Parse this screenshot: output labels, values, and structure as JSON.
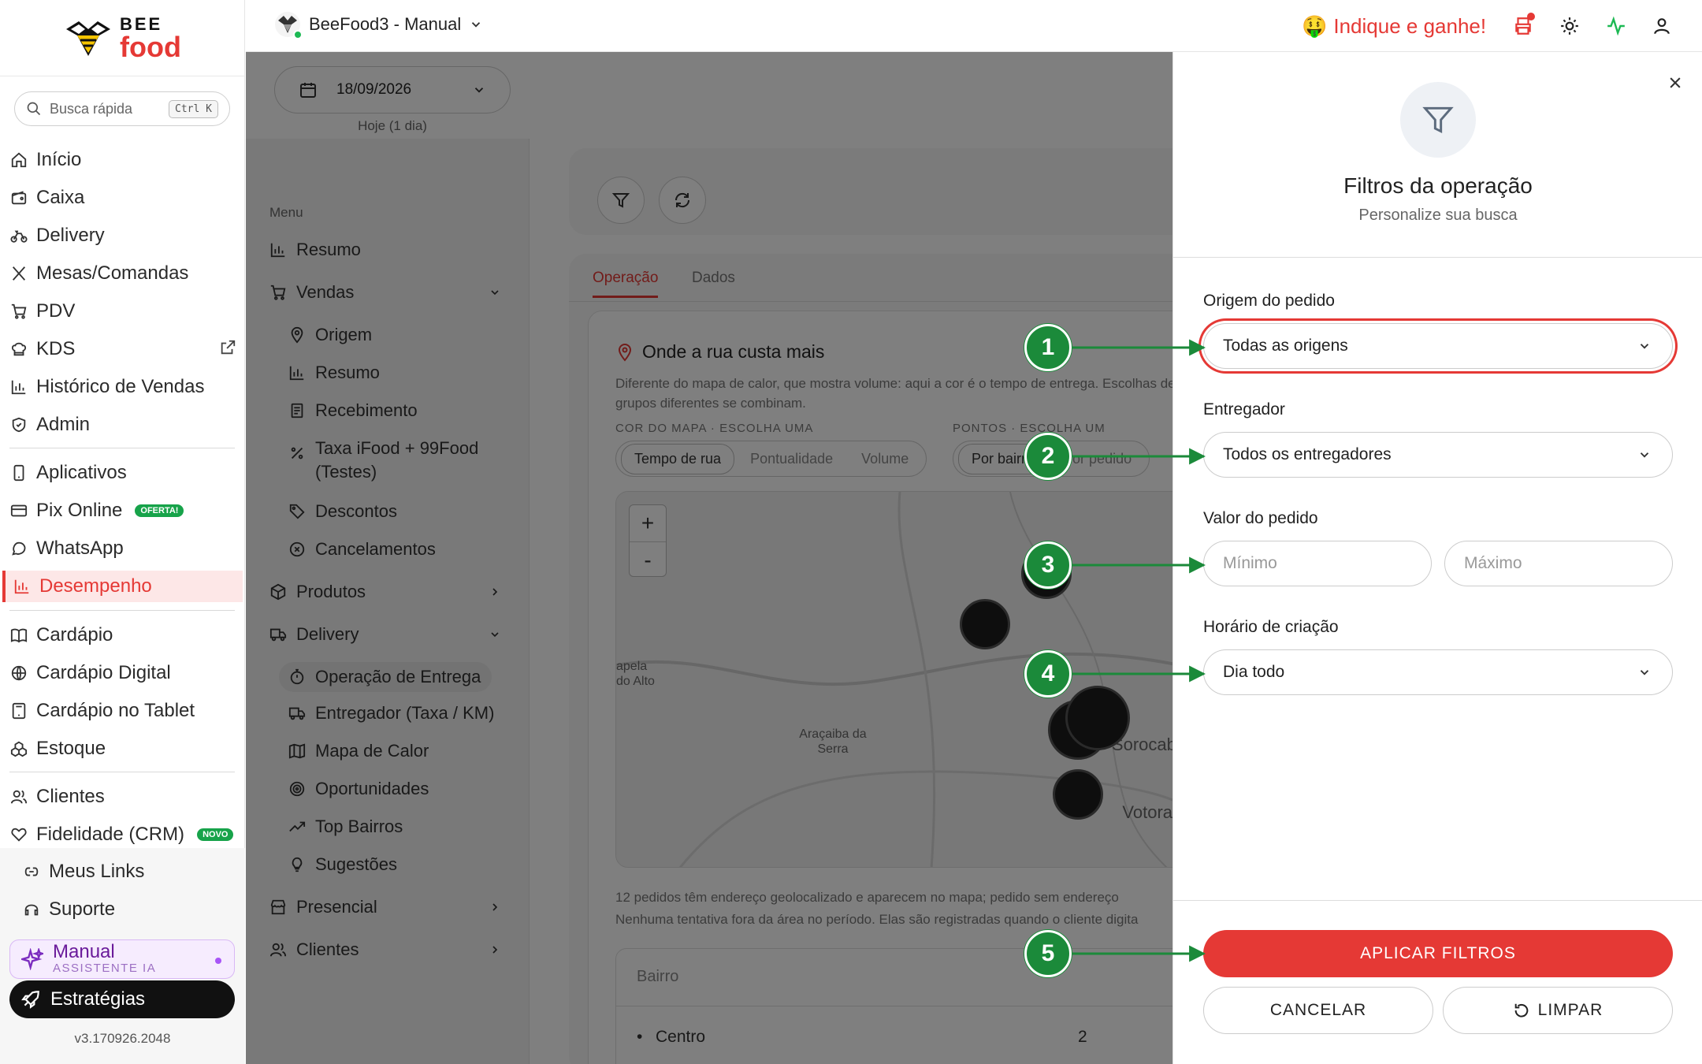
{
  "brand": {
    "line1": "BEE",
    "line2": "food"
  },
  "search": {
    "placeholder": "Busca rápida",
    "shortcut": "Ctrl K"
  },
  "sidebar": {
    "items": [
      {
        "label": "Início"
      },
      {
        "label": "Caixa"
      },
      {
        "label": "Delivery"
      },
      {
        "label": "Mesas/Comandas"
      },
      {
        "label": "PDV"
      },
      {
        "label": "KDS"
      },
      {
        "label": "Histórico de Vendas"
      },
      {
        "label": "Admin"
      },
      {
        "label": "Aplicativos"
      },
      {
        "label": "Pix Online",
        "badge": "OFERTA!"
      },
      {
        "label": "WhatsApp"
      },
      {
        "label": "Desempenho"
      },
      {
        "label": "Cardápio"
      },
      {
        "label": "Cardápio Digital"
      },
      {
        "label": "Cardápio no Tablet"
      },
      {
        "label": "Estoque"
      },
      {
        "label": "Clientes"
      },
      {
        "label": "Fidelidade (CRM)",
        "badge": "NOVO"
      }
    ],
    "bottom": [
      {
        "label": "Meus Links"
      },
      {
        "label": "Suporte"
      }
    ],
    "manual": {
      "title": "Manual",
      "subtitle": "ASSISTENTE IA"
    },
    "strategies": "Estratégias",
    "version": "v3.170926.2048",
    "active": "Desempenho"
  },
  "topbar": {
    "app_name": "BeeFood3 - Manual",
    "refer": "Indique e ganhe!",
    "refer_emoji": "🤑",
    "colors": {
      "accent": "#e53935",
      "pulse": "#1db954"
    }
  },
  "main": {
    "date": "18/09/2026",
    "date_caption": "Hoje (1 dia)",
    "menu_head": "Menu",
    "submenu": [
      {
        "label": "Resumo"
      },
      {
        "label": "Vendas"
      },
      {
        "label": "Origem"
      },
      {
        "label": "Resumo"
      },
      {
        "label": "Recebimento"
      },
      {
        "label": "Taxa iFood + 99Food"
      },
      {
        "label": "(Testes)"
      },
      {
        "label": "Descontos"
      },
      {
        "label": "Cancelamentos"
      },
      {
        "label": "Produtos"
      },
      {
        "label": "Delivery"
      },
      {
        "label": "Operação de Entrega"
      },
      {
        "label": "Entregador (Taxa / KM)"
      },
      {
        "label": "Mapa de Calor"
      },
      {
        "label": "Oportunidades"
      },
      {
        "label": "Top Bairros"
      },
      {
        "label": "Sugestões"
      },
      {
        "label": "Presencial"
      },
      {
        "label": "Clientes"
      }
    ],
    "tabs": [
      {
        "label": "Operação"
      },
      {
        "label": "Dados"
      }
    ],
    "section_title": "Onde a rua custa mais",
    "section_desc": "Diferente do mapa de calor, que mostra volume: aqui a cor é o tempo de entrega. Escolhas de grupos diferentes se combinam.",
    "color_caption": "COR DO MAPA · ESCOLHA UMA",
    "color_options": [
      "Tempo de rua",
      "Pontualidade",
      "Volume"
    ],
    "points_caption": "PONTOS · ESCOLHA UM",
    "points_options": [
      "Por bairro",
      "Por pedido"
    ],
    "map_labels": [
      "Araçaiba da Serra",
      "apela do Alto",
      "Sorocaba",
      "Votorantim"
    ],
    "map_note_1": "12 pedidos têm endereço geolocalizado e aparecem no mapa; pedido sem endereço",
    "map_note_2": "Nenhuma tentativa fora da área no período. Elas são registradas quando o cliente digita",
    "table_head": "Bairro",
    "table_row": {
      "name": "Centro",
      "count": "2"
    }
  },
  "panel": {
    "title": "Filtros da operação",
    "subtitle": "Personalize sua busca",
    "origin_label": "Origem do pedido",
    "origin_value": "Todas as origens",
    "courier_label": "Entregador",
    "courier_value": "Todos os entregadores",
    "value_label": "Valor do pedido",
    "min_placeholder": "Mínimo",
    "max_placeholder": "Máximo",
    "time_label": "Horário de criação",
    "time_value": "Dia todo",
    "apply": "APLICAR FILTROS",
    "cancel": "CANCELAR",
    "clear": "LIMPAR"
  },
  "callouts": [
    "1",
    "2",
    "3",
    "4",
    "5"
  ]
}
